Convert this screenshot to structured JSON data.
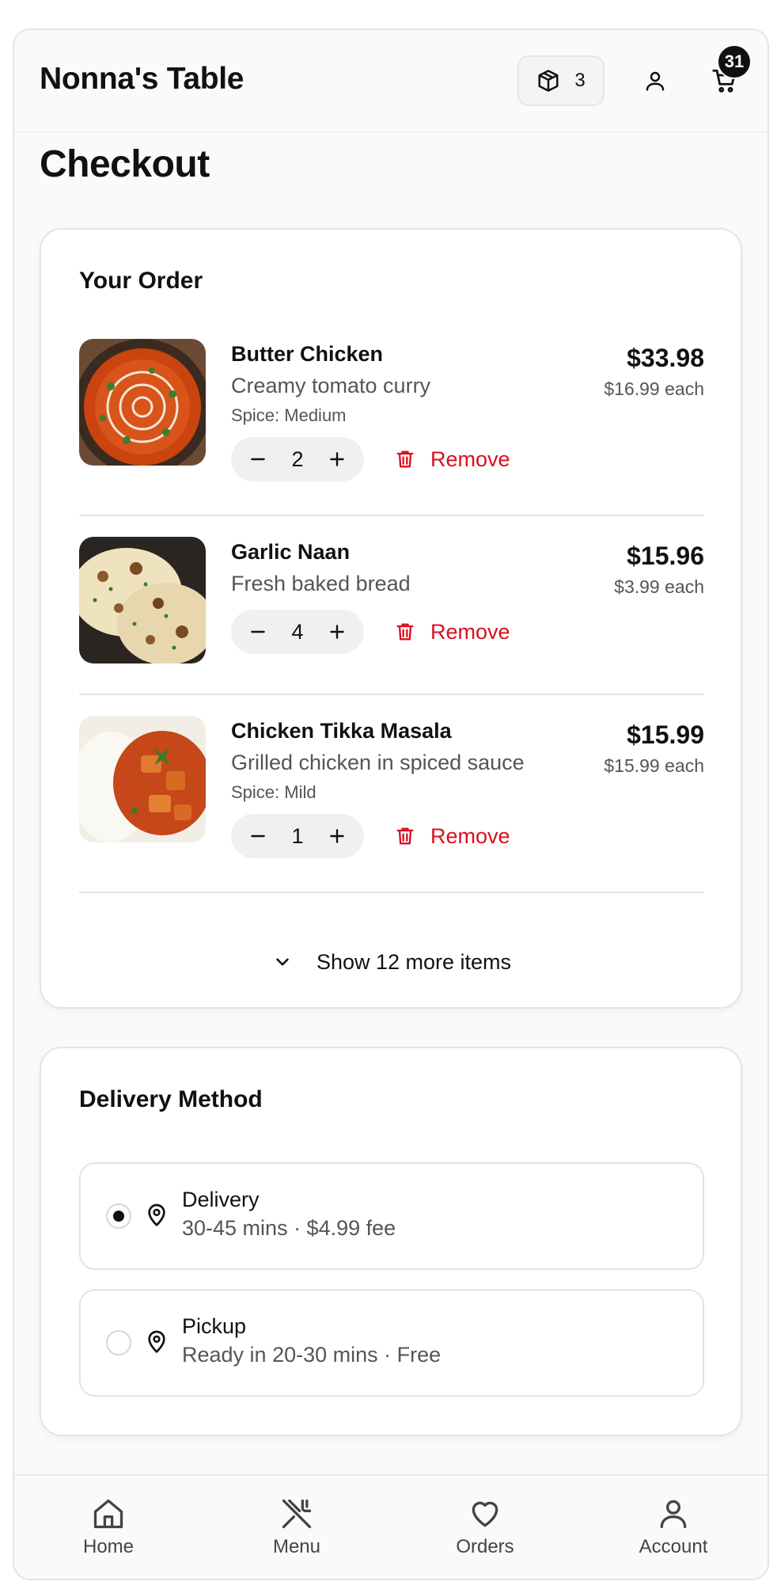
{
  "header": {
    "brand": "Nonna's Table",
    "orders_count": "3",
    "cart_badge": "31"
  },
  "page": {
    "title": "Checkout"
  },
  "order": {
    "title": "Your Order",
    "items": [
      {
        "name": "Butter Chicken",
        "description": "Creamy tomato curry",
        "spice": "Spice: Medium",
        "quantity": "2",
        "total": "$33.98",
        "each": "$16.99 each",
        "remove_label": "Remove",
        "image": "butter-chicken"
      },
      {
        "name": "Garlic Naan",
        "description": "Fresh baked bread",
        "spice": "",
        "quantity": "4",
        "total": "$15.96",
        "each": "$3.99 each",
        "remove_label": "Remove",
        "image": "garlic-naan"
      },
      {
        "name": "Chicken Tikka Masala",
        "description": "Grilled chicken in spiced sauce",
        "spice": "Spice: Mild",
        "quantity": "1",
        "total": "$15.99",
        "each": "$15.99 each",
        "remove_label": "Remove",
        "image": "chicken-tikka-masala"
      }
    ],
    "show_more_label": "Show 12 more items"
  },
  "delivery": {
    "title": "Delivery Method",
    "options": [
      {
        "title": "Delivery",
        "subtitle": "30-45 mins · $4.99 fee",
        "selected": true
      },
      {
        "title": "Pickup",
        "subtitle": "Ready in 20-30 mins · Free",
        "selected": false
      }
    ]
  },
  "nav": {
    "items": [
      {
        "label": "Home",
        "icon": "home-icon"
      },
      {
        "label": "Menu",
        "icon": "utensils-icon"
      },
      {
        "label": "Orders",
        "icon": "heart-icon"
      },
      {
        "label": "Account",
        "icon": "user-icon"
      }
    ]
  },
  "colors": {
    "remove": "#d90f1f",
    "text": "#111111",
    "muted": "#555555",
    "badge": "#111111"
  }
}
